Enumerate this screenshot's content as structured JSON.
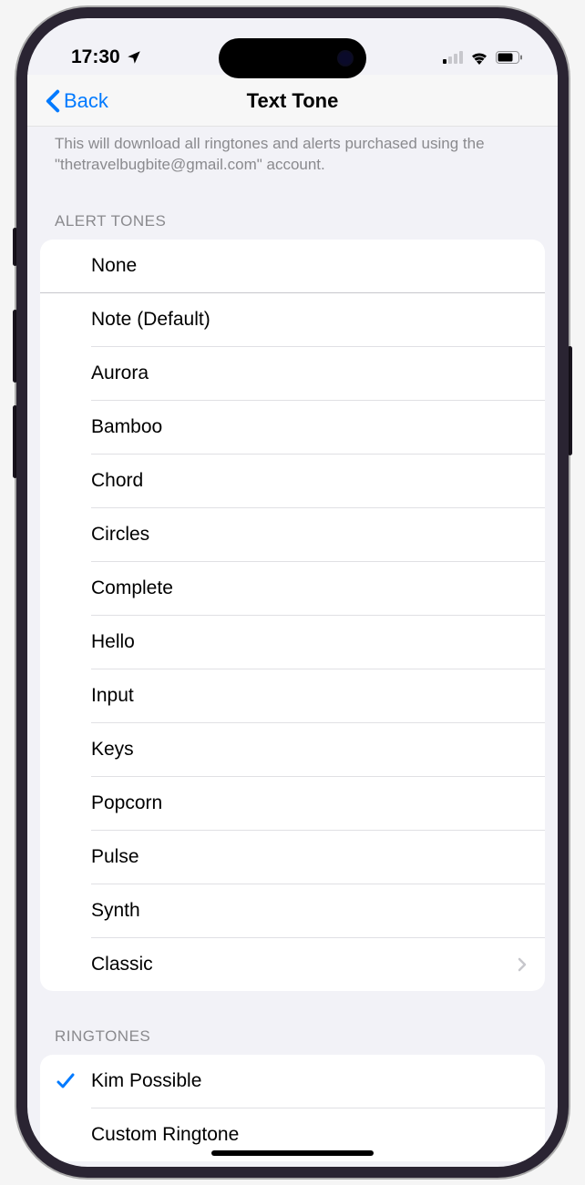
{
  "statusBar": {
    "time": "17:30"
  },
  "nav": {
    "backLabel": "Back",
    "title": "Text Tone"
  },
  "description": "This will download all ringtones and alerts purchased using the \"thetravelbugbite@gmail.com\" account.",
  "sections": {
    "alertTones": {
      "header": "ALERT TONES",
      "items": [
        {
          "label": "None"
        },
        {
          "label": "Note (Default)"
        },
        {
          "label": "Aurora"
        },
        {
          "label": "Bamboo"
        },
        {
          "label": "Chord"
        },
        {
          "label": "Circles"
        },
        {
          "label": "Complete"
        },
        {
          "label": "Hello"
        },
        {
          "label": "Input"
        },
        {
          "label": "Keys"
        },
        {
          "label": "Popcorn"
        },
        {
          "label": "Pulse"
        },
        {
          "label": "Synth"
        },
        {
          "label": "Classic",
          "hasChevron": true
        }
      ]
    },
    "ringtones": {
      "header": "RINGTONES",
      "items": [
        {
          "label": "Kim Possible",
          "selected": true
        },
        {
          "label": "Custom Ringtone"
        }
      ]
    }
  }
}
